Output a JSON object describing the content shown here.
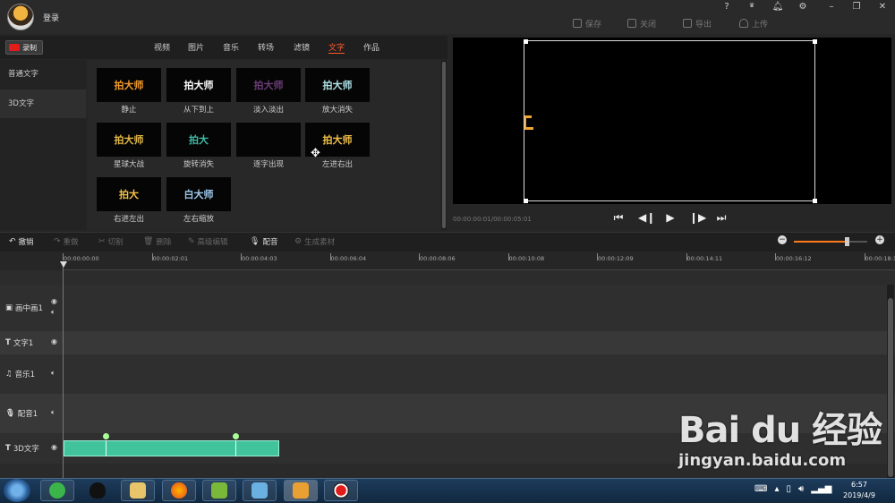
{
  "titlebar": {
    "login_label": "登录",
    "window_controls": [
      "?",
      "VIP",
      "bell",
      "gear",
      "minimize",
      "restore",
      "close"
    ],
    "actions": [
      {
        "label": "保存",
        "icon": "save-icon"
      },
      {
        "label": "关闭",
        "icon": "close-project-icon"
      },
      {
        "label": "导出",
        "icon": "export-icon"
      },
      {
        "label": "上传",
        "icon": "upload-icon"
      }
    ]
  },
  "record_label": "录制",
  "tabs": [
    "视频",
    "图片",
    "音乐",
    "转场",
    "滤镜",
    "文字",
    "作品"
  ],
  "active_tab": "文字",
  "categories": [
    "普通文字",
    "3D文字"
  ],
  "selected_category": "3D文字",
  "effects": [
    {
      "thumb": "拍大师",
      "label": "静止",
      "color": "#f39a2c"
    },
    {
      "thumb": "拍大师",
      "label": "从下到上",
      "color": "#ffffff"
    },
    {
      "thumb": "拍大师",
      "label": "淡入淡出",
      "color": "#6a3d75"
    },
    {
      "thumb": "拍大师",
      "label": "放大消失",
      "color": "#aee3e8"
    },
    {
      "thumb": "拍大师",
      "label": "星球大战",
      "color": "#e3b84a"
    },
    {
      "thumb": "拍大",
      "label": "旋转消失",
      "color": "#3ebba6"
    },
    {
      "thumb": "",
      "label": "逐字出现",
      "color": "#ffffff"
    },
    {
      "thumb": "拍大师",
      "label": "左进右出",
      "color": "#f2c04a"
    },
    {
      "thumb": "拍大",
      "label": "右进左出",
      "color": "#f2c04a"
    },
    {
      "thumb": "白大师",
      "label": "左右缩放",
      "color": "#9fc9ee"
    }
  ],
  "preview": {
    "timecode": "00:00:00:01/00:00:05:01",
    "controls": [
      "skip-start-icon",
      "step-back-icon",
      "play-icon",
      "step-forward-icon",
      "skip-end-icon"
    ]
  },
  "toolbar": [
    {
      "label": "撤销",
      "icon": "undo-icon",
      "enabled": true
    },
    {
      "label": "重做",
      "icon": "redo-icon",
      "enabled": false
    },
    {
      "label": "切割",
      "icon": "cut-icon",
      "enabled": false
    },
    {
      "label": "删除",
      "icon": "delete-icon",
      "enabled": false
    },
    {
      "label": "高级编辑",
      "icon": "edit-icon",
      "enabled": false
    },
    {
      "label": "配音",
      "icon": "mic-icon",
      "enabled": true
    },
    {
      "label": "生成素材",
      "icon": "gen-icon",
      "enabled": false
    }
  ],
  "zoom_level": 0.73,
  "ruler": [
    "00:00:00:00",
    "00:00:02:01",
    "00:00:04:03",
    "00:00:06:04",
    "00:00:08:06",
    "00:00:10:08",
    "00:00:12:09",
    "00:00:14:11",
    "00:00:16:12",
    "00:00:18:1"
  ],
  "tracks": [
    {
      "name": "画中画1",
      "icon": "pip-icon",
      "controls": [
        "eye",
        "speaker"
      ]
    },
    {
      "name": "文字1",
      "icon": "text-icon",
      "controls": [
        "eye"
      ]
    },
    {
      "name": "音乐1",
      "icon": "music-icon",
      "controls": [
        "speaker"
      ]
    },
    {
      "name": "配音1",
      "icon": "mic-icon",
      "controls": [
        "speaker"
      ]
    },
    {
      "name": "3D文字",
      "icon": "text-icon",
      "controls": [
        "eye"
      ]
    }
  ],
  "taskbar": {
    "apps": [
      "start-orb-icon",
      "360-icon",
      "qq-icon",
      "explorer-icon",
      "firefox-icon",
      "media-icon",
      "pen-icon",
      "paidashi-icon",
      "record-icon"
    ],
    "time": "6:57",
    "date": "2019/4/9"
  },
  "watermark": {
    "logo": "Bai du 经验",
    "url": "jingyan.baidu.com"
  }
}
